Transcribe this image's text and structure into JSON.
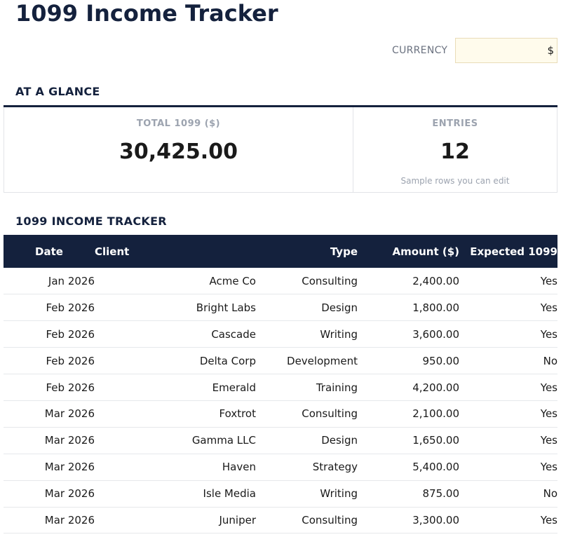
{
  "header": {
    "title": "1099 Income Tracker",
    "currency_label": "CURRENCY",
    "currency_value": "$"
  },
  "glance": {
    "heading": "AT A GLANCE",
    "total_label": "TOTAL 1099 ($)",
    "total_value": "30,425.00",
    "entries_label": "ENTRIES",
    "entries_value": "12",
    "entries_note": "Sample rows you can edit"
  },
  "tracker": {
    "heading": "1099 INCOME TRACKER",
    "columns": [
      "Date",
      "Client",
      "Type",
      "Amount ($)",
      "Expected 1099"
    ],
    "rows": [
      [
        "Jan 2026",
        "Acme Co",
        "Consulting",
        "2,400.00",
        "Yes"
      ],
      [
        "Feb 2026",
        "Bright Labs",
        "Design",
        "1,800.00",
        "Yes"
      ],
      [
        "Feb 2026",
        "Cascade",
        "Writing",
        "3,600.00",
        "Yes"
      ],
      [
        "Feb 2026",
        "Delta Corp",
        "Development",
        "950.00",
        "No"
      ],
      [
        "Feb 2026",
        "Emerald",
        "Training",
        "4,200.00",
        "Yes"
      ],
      [
        "Mar 2026",
        "Foxtrot",
        "Consulting",
        "2,100.00",
        "Yes"
      ],
      [
        "Mar 2026",
        "Gamma LLC",
        "Design",
        "1,650.00",
        "Yes"
      ],
      [
        "Mar 2026",
        "Haven",
        "Strategy",
        "5,400.00",
        "Yes"
      ],
      [
        "Mar 2026",
        "Isle Media",
        "Writing",
        "875.00",
        "No"
      ],
      [
        "Mar 2026",
        "Juniper",
        "Consulting",
        "3,300.00",
        "Yes"
      ]
    ]
  }
}
